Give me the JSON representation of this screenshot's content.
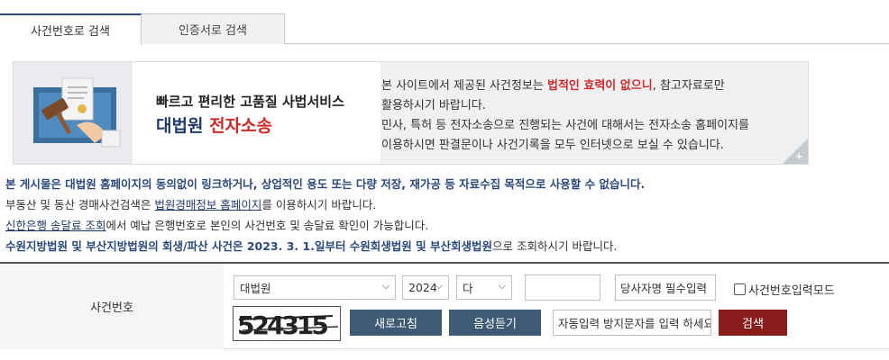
{
  "tabs": [
    {
      "label": "사건번호로 검색",
      "active": true
    },
    {
      "label": "인증서로 검색",
      "active": false
    }
  ],
  "banner": {
    "title_line1": "빠르고 편리한 고품질 사법서비스",
    "title_line2_a": "대법원",
    "title_line2_b": "전자소송",
    "desc_1a": "본 사이트에서 제공된 사건정보는 ",
    "desc_1b": "법적인 효력이 없으니",
    "desc_1c": ", 참고자료로만",
    "desc_2": "활용하시기 바랍니다.",
    "desc_3": "민사, 특허 등 전자소송으로 진행되는 사건에 대해서는 전자소송 홈페이지를",
    "desc_4": "이용하시면 판결문이나 사건기록을 모두 인터넷으로 보실 수 있습니다.",
    "corner_symbol": "+"
  },
  "notices": {
    "n1": "본 게시물은 대법원 홈페이지의 동의없이 링크하거나, 상업적인 용도 또는 다량 저장, 재가공 등 자료수집 목적으로 사용할 수 없습니다.",
    "n2_a": "부동산 및 동산 경매사건검색은 ",
    "n2_link": "법원경매정보 홈페이지",
    "n2_b": "를 이용하시기 바랍니다.",
    "n3_link": "신한은행 송달료 조회",
    "n3_b": "에서 예납 은행번호로 본인의 사건번호 및 송달료 확인이 가능합니다.",
    "n4_bold": "수원지방법원 및 부산지방법원의 회생/파산 사건은 2023. 3. 1.일부터 수원회생법원 및 부산회생법원",
    "n4_b": "으로 조회하시기 바랍니다."
  },
  "form": {
    "label": "사건번호",
    "court_value": "대법원",
    "year_value": "2024",
    "type_value": "다",
    "number_value": "",
    "party_placeholder": "당사자명 필수입력",
    "mode_checkbox_label": "사건번호입력모드",
    "captcha_text": "524315",
    "refresh_button": "새로고침",
    "audio_button": "음성듣기",
    "captcha_input_placeholder": "자동입력 방지문자를 입력 하세요",
    "search_button": "검색"
  },
  "colors": {
    "brand_blue": "#2b4a7a",
    "alert_red": "#d12a2a",
    "button_dark": "#3f5a75",
    "button_red": "#8a1c1c"
  }
}
